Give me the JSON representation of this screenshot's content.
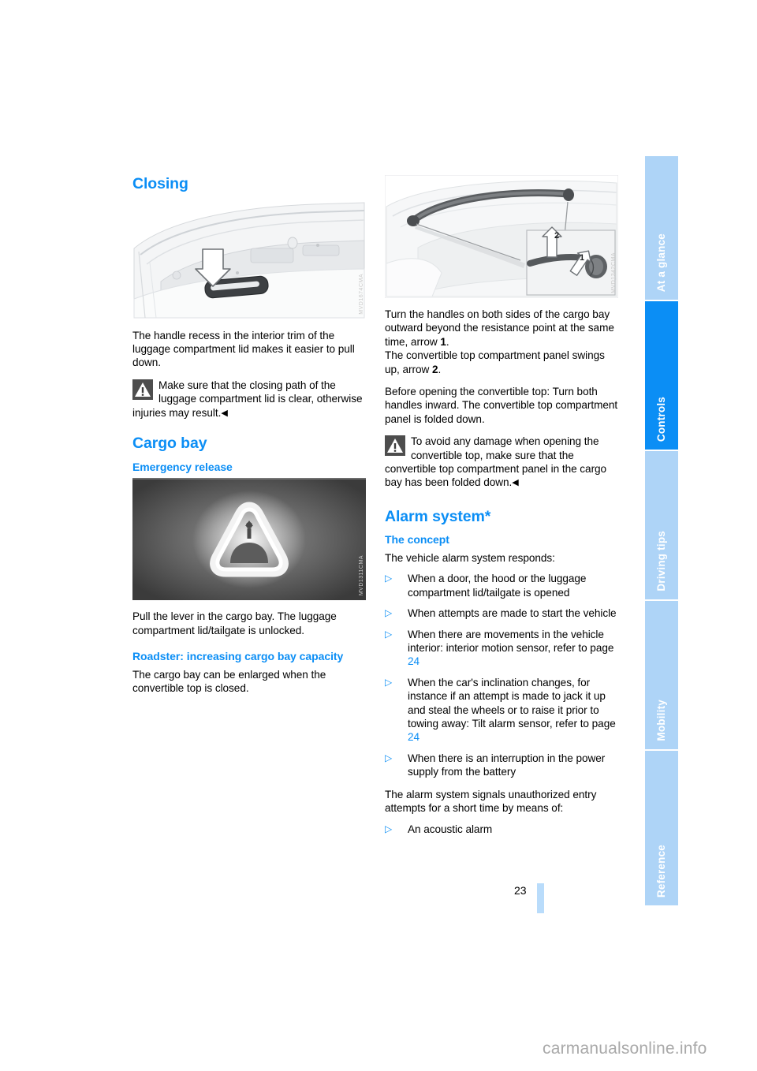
{
  "document": {
    "page_number": "23",
    "watermark": "carmanualsonline.info"
  },
  "tabs": [
    {
      "label": "At a glance",
      "active": false
    },
    {
      "label": "Controls",
      "active": true
    },
    {
      "label": "Driving tips",
      "active": false
    },
    {
      "label": "Mobility",
      "active": false
    },
    {
      "label": "Reference",
      "active": false
    }
  ],
  "colors": {
    "heading_blue": "#0b8ef5",
    "tab_inactive": "#aed4f7",
    "tab_active": "#0b8ef5",
    "page_bar": "#b9dcfb"
  },
  "left_column": {
    "closing_heading": "Closing",
    "figure_closing_caption_code": "MVD1674CMA",
    "closing_paragraph": "The handle recess in the interior trim of the luggage compartment lid makes it easier to pull down.",
    "closing_warning": "Make sure that the closing path of the luggage compartment lid is clear, otherwise injuries may result.",
    "cargo_bay_heading": "Cargo bay",
    "emergency_release_heading": "Emergency release",
    "figure_emergency_caption_code": "MVD1311CMA",
    "emergency_release_paragraph": "Pull the lever in the cargo bay. The luggage compartment lid/tailgate is unlocked.",
    "roadster_heading": "Roadster: increasing cargo bay capacity",
    "roadster_paragraph": "The cargo bay can be enlarged when the convertible top is closed."
  },
  "right_column": {
    "figure_cargo_caption_code": "MVD1342CMA",
    "figure_inset_arrow_1": "1",
    "figure_inset_arrow_2": "2",
    "paragraph_1_part_a": "Turn the handles on both sides of the cargo bay outward beyond the resistance point at the same time, arrow ",
    "paragraph_1_bold": "1",
    "paragraph_1_part_b": ".",
    "paragraph_2_part_a": "The convertible top compartment panel swings up, arrow ",
    "paragraph_2_bold": "2",
    "paragraph_2_part_b": ".",
    "paragraph_3": "Before opening the convertible top: Turn both handles inward. The convertible top compartment panel is folded down.",
    "warning": "To avoid any damage when opening the convertible top, make sure that the convertible top compartment panel in the cargo bay has been folded down.",
    "alarm_heading": "Alarm system*",
    "concept_heading": "The concept",
    "concept_intro": "The vehicle alarm system responds:",
    "responds_list": [
      {
        "text": "When a door, the hood or the luggage compartment lid/tailgate is opened"
      },
      {
        "text": "When attempts are made to start the vehicle"
      },
      {
        "text": "When there are movements in the vehicle interior: interior motion sensor, refer to page ",
        "page_ref": "24"
      },
      {
        "text": "When the car's inclination changes, for instance if an attempt is made to jack it up and steal the wheels or to raise it prior to towing away: Tilt alarm sensor, refer to page ",
        "page_ref": "24"
      },
      {
        "text": "When there is an interruption in the power supply from the battery"
      }
    ],
    "signals_intro": "The alarm system signals unauthorized entry attempts for a short time by means of:",
    "signals_list": [
      {
        "text": "An acoustic alarm"
      }
    ]
  }
}
